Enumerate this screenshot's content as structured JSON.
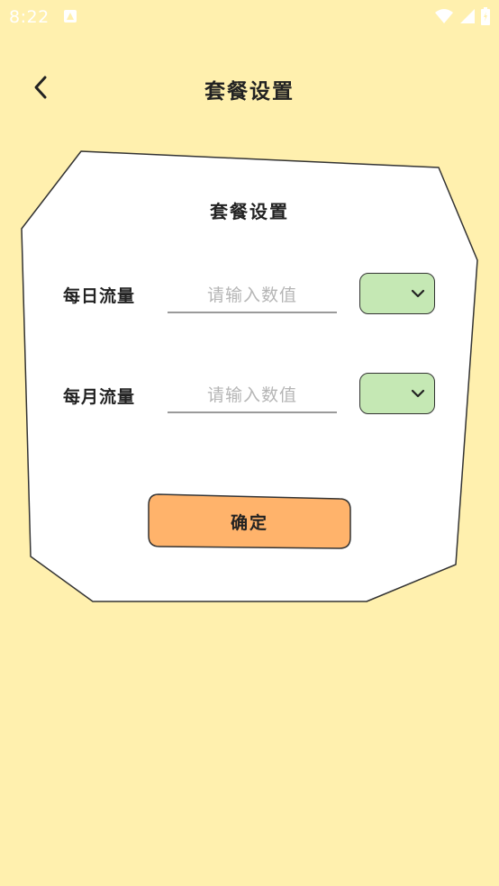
{
  "status_bar": {
    "time": "8:22"
  },
  "header": {
    "title": "套餐设置"
  },
  "card": {
    "title": "套餐设置",
    "rows": [
      {
        "label": "每日流量",
        "placeholder": "请输入数值",
        "value": "",
        "unit": ""
      },
      {
        "label": "每月流量",
        "placeholder": "请输入数值",
        "value": "",
        "unit": ""
      }
    ],
    "confirm_label": "确定"
  },
  "colors": {
    "background": "#FFF0AE",
    "card": "#FFFFFF",
    "unit_select": "#C5E8B4",
    "confirm_button": "#FFB36B"
  },
  "icons": {
    "back": "chevron-left-icon",
    "dropdown": "chevron-down-icon",
    "notification": "notification-icon",
    "wifi": "wifi-icon",
    "signal": "signal-icon",
    "battery": "battery-icon"
  }
}
